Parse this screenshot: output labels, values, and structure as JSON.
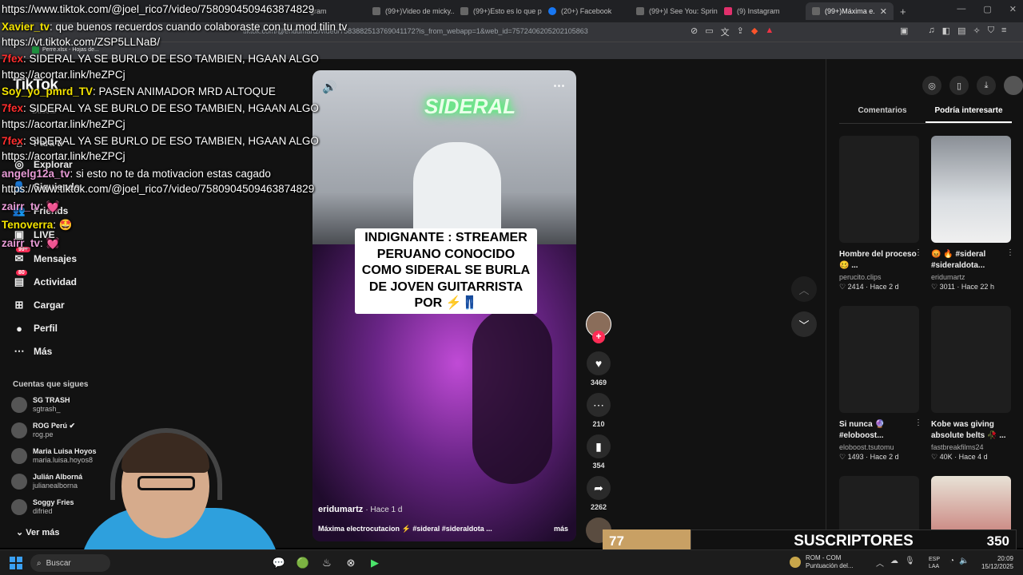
{
  "browser": {
    "tabs": [
      {
        "label": "gram",
        "active": false
      },
      {
        "label": "(99+)Video de micky...",
        "active": false
      },
      {
        "label": "(99+)Esto es lo que pa...",
        "active": false
      },
      {
        "label": "(20+) Facebook",
        "active": false
      },
      {
        "label": "(99+)I See You: Spring...",
        "active": false
      },
      {
        "label": "(9) Instagram",
        "active": false
      },
      {
        "label": "(99+)Máxima e...",
        "active": true
      }
    ],
    "close_glyph": "✕",
    "new_tab_glyph": "+",
    "window_controls": [
      "—",
      "▢",
      "✕"
    ],
    "url": "tiktok.com/@eridumartz/video/7583882513769041172?is_from_webapp=1&web_id=7572406205202105863",
    "bookmark": "Perre.xlsx - Hojas de..."
  },
  "tiktok": {
    "logo": "TikTok",
    "search_placeholder": "Buscar",
    "nav": [
      {
        "label": "Para ti",
        "icon": "home-icon",
        "glyph": "⌂"
      },
      {
        "label": "Explorar",
        "icon": "compass-icon",
        "glyph": "◎"
      },
      {
        "label": "Siguiendo",
        "icon": "following-icon",
        "glyph": "👤"
      },
      {
        "label": "Friends",
        "icon": "friends-icon",
        "glyph": "👥"
      },
      {
        "label": "LIVE",
        "icon": "live-icon",
        "glyph": "▣"
      },
      {
        "label": "Mensajes",
        "icon": "messages-icon",
        "glyph": "✉",
        "badge": "99+"
      },
      {
        "label": "Actividad",
        "icon": "activity-icon",
        "glyph": "▤",
        "badge": "80"
      },
      {
        "label": "Cargar",
        "icon": "upload-icon",
        "glyph": "⊞"
      },
      {
        "label": "Perfil",
        "icon": "profile-icon",
        "glyph": "●"
      },
      {
        "label": "Más",
        "icon": "more-icon",
        "glyph": "⋯"
      }
    ],
    "following_title": "Cuentas que sigues",
    "following": [
      {
        "name": "SG TRASH",
        "handle": "sgtrash_"
      },
      {
        "name": "ROG Perú ✔",
        "handle": "rog.pe"
      },
      {
        "name": "Maria Luisa Hoyos",
        "handle": "maria.luisa.hoyos8"
      },
      {
        "name": "Julián Alborná",
        "handle": "julianealborna"
      },
      {
        "name": "Soggy Fries",
        "handle": "difried"
      }
    ],
    "see_more": "Ver más",
    "video": {
      "sign": "SIDERAL",
      "caption": "INDIGNANTE : STREAMER PERUANO CONOCIDO COMO SIDERAL SE BURLA DE JOVEN GUITARRISTA POR ⚡👖",
      "author": "eridumartz",
      "time": "· Hace 1 d",
      "description": "Máxima electrocutacion ⚡ #sideral #sideraldota ...",
      "more": "más"
    },
    "actions": {
      "follow_glyph": "+",
      "likes": "3469",
      "comments": "210",
      "saves": "354",
      "shares": "2262"
    },
    "panel": {
      "tabs": [
        "Comentarios",
        "Podría interesarte"
      ],
      "active_tab": 1,
      "cards": [
        {
          "title": "Hombre del proceso 🥴 ...",
          "user": "perucito.clips",
          "stats": "♡ 2414 · Hace 2 d"
        },
        {
          "title": "😡 🔥 #sideral #sideraldota...",
          "user": "eridumartz",
          "stats": "♡ 3011 · Hace 22 h"
        },
        {
          "title": "Si nunca 🔮 #eloboost...",
          "user": "eloboost.tsutomu",
          "stats": "♡ 1493 · Hace 2 d"
        },
        {
          "title": "Kobe was giving absolute belts 🥀 ...",
          "user": "fastbreakfilms24",
          "stats": "♡ 40K · Hace 4 d"
        }
      ]
    }
  },
  "chat": [
    {
      "user": "",
      "text": "https://www.tiktok.com/@joel_rico7/video/7580904509463874829",
      "color": "white"
    },
    {
      "user": "Xavier_tv",
      "text": ": que buenos recuerdos cuando colaboraste con tu mod tilin tv",
      "color": "yellow"
    },
    {
      "user": "",
      "text": "https://vt.tiktok.com/ZSP5LLNaB/",
      "color": "white"
    },
    {
      "user": "7fex",
      "text": ": SIDERAL YA SE BURLO DE ESO TAMBIEN, HGAAN ALGO",
      "color": "red"
    },
    {
      "user": "",
      "text": "https://acortar.link/heZPCj",
      "color": "white"
    },
    {
      "user": "Soy_yo_pmrd_TV",
      "text": ": PASEN ANIMADOR MRD ALTOQUE",
      "color": "yellow"
    },
    {
      "user": "7fex",
      "text": ": SIDERAL YA SE BURLO DE ESO TAMBIEN, HGAAN ALGO",
      "color": "red"
    },
    {
      "user": "",
      "text": "https://acortar.link/heZPCj",
      "color": "white"
    },
    {
      "user": "7fex",
      "text": ": SIDERAL YA SE BURLO DE ESO TAMBIEN, HGAAN ALGO",
      "color": "red"
    },
    {
      "user": "",
      "text": "https://acortar.link/heZPCj",
      "color": "white"
    },
    {
      "user": "angelg12a_tv",
      "text": ": si esto no te da motivacion estas cagado",
      "color": "pink"
    },
    {
      "user": "",
      "text": "https://www.tiktok.com/@joel_rico7/video/7580904509463874829",
      "color": "white"
    },
    {
      "user": "zairr_tv",
      "text": ": 💓",
      "color": "pink"
    },
    {
      "user": "Tenoverra",
      "text": ": 🤩",
      "color": "yellow"
    },
    {
      "user": "zairr_tv",
      "text": ": 💓",
      "color": "pink"
    }
  ],
  "subscribers": {
    "count": "77",
    "label": "SUSCRIPTORES",
    "goal": "350"
  },
  "taskbar": {
    "search": "Buscar",
    "apps": [
      "💬",
      "🟢",
      "♨",
      "⊗",
      "▶"
    ],
    "media_title": "ROM - COM",
    "media_sub": "Puntuación del...",
    "lang_1": "ESP",
    "lang_2": "LAA",
    "time": "20:09",
    "date": "15/12/2025"
  }
}
